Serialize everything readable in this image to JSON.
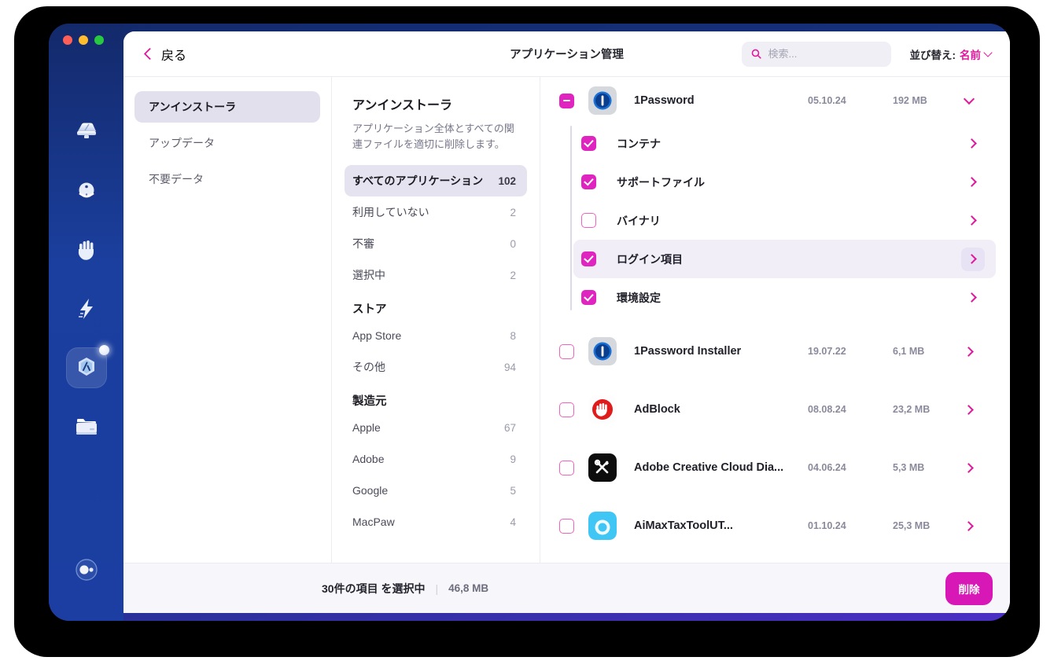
{
  "window": {
    "title": "アプリケーション管理",
    "back_label": "戻る",
    "traffic_lights": [
      "close-red",
      "minimize-yellow",
      "zoom-green"
    ]
  },
  "search": {
    "placeholder": "検索...",
    "value": "",
    "icon": "search-icon"
  },
  "sort": {
    "label": "並び替え:",
    "value": "名前",
    "icon": "chevron-down-icon"
  },
  "rail": {
    "items": [
      {
        "name": "cleanup-icon",
        "active": false
      },
      {
        "name": "scan-orb-icon",
        "active": false
      },
      {
        "name": "protection-hand-icon",
        "active": false
      },
      {
        "name": "speed-bolt-icon",
        "active": false
      },
      {
        "name": "applications-icon",
        "active": true,
        "badge": true
      },
      {
        "name": "files-drawer-icon",
        "active": false
      }
    ],
    "bottom": {
      "name": "assistant-icon",
      "active": false
    }
  },
  "nav": {
    "items": [
      {
        "label": "アンインストーラ",
        "active": true
      },
      {
        "label": "アップデータ",
        "active": false
      },
      {
        "label": "不要データ",
        "active": false
      }
    ]
  },
  "filters": {
    "title": "アンインストーラ",
    "description": "アプリケーション全体とすべての関連ファイルを適切に削除します。",
    "rows": [
      {
        "label": "すべてのアプリケーション",
        "count": "102",
        "active": true
      },
      {
        "label": "利用していない",
        "count": "2",
        "active": false
      },
      {
        "label": "不審",
        "count": "0",
        "active": false
      },
      {
        "label": "選択中",
        "count": "2",
        "active": false
      }
    ],
    "store_group": "ストア",
    "store_rows": [
      {
        "label": "App Store",
        "count": "8"
      },
      {
        "label": "その他",
        "count": "94"
      }
    ],
    "vendor_group": "製造元",
    "vendor_rows": [
      {
        "label": "Apple",
        "count": "67"
      },
      {
        "label": "Adobe",
        "count": "9"
      },
      {
        "label": "Google",
        "count": "5"
      },
      {
        "label": "MacPaw",
        "count": "4"
      }
    ]
  },
  "apps": [
    {
      "name": "1Password",
      "date": "05.10.24",
      "size": "192 MB",
      "check": "mixed",
      "icon": "onepassword-icon",
      "expanded": true,
      "children": [
        {
          "label": "コンテナ",
          "check": "on",
          "hover": false
        },
        {
          "label": "サポートファイル",
          "check": "on",
          "hover": false
        },
        {
          "label": "バイナリ",
          "check": "off",
          "hover": false
        },
        {
          "label": "ログイン項目",
          "check": "on",
          "hover": true
        },
        {
          "label": "環境設定",
          "check": "on",
          "hover": false
        }
      ]
    },
    {
      "name": "1Password Installer",
      "date": "19.07.22",
      "size": "6,1 MB",
      "check": "off",
      "icon": "onepassword-icon",
      "expanded": false,
      "children": []
    },
    {
      "name": "AdBlock",
      "date": "08.08.24",
      "size": "23,2 MB",
      "check": "off",
      "icon": "adblock-icon",
      "expanded": false,
      "children": []
    },
    {
      "name": "Adobe Creative Cloud Dia...",
      "date": "04.06.24",
      "size": "5,3 MB",
      "check": "off",
      "icon": "adobe-tools-icon",
      "expanded": false,
      "children": []
    },
    {
      "name": "AiMaxTaxToolUT...",
      "date": "01.10.24",
      "size": "25,3 MB",
      "check": "off",
      "icon": "aimax-icon",
      "expanded": false,
      "children": []
    }
  ],
  "status": {
    "count_text": "30件の項目 を選択中",
    "separator": "|",
    "size_text": "46,8 MB",
    "delete_label": "削除"
  },
  "colors": {
    "accent_magenta": "#e2179c",
    "checkbox_magenta": "#e024c0",
    "delete_button": "#d818b6",
    "rail_blue": "#1b3f9e",
    "selection_lavender": "#e3e0ee"
  }
}
